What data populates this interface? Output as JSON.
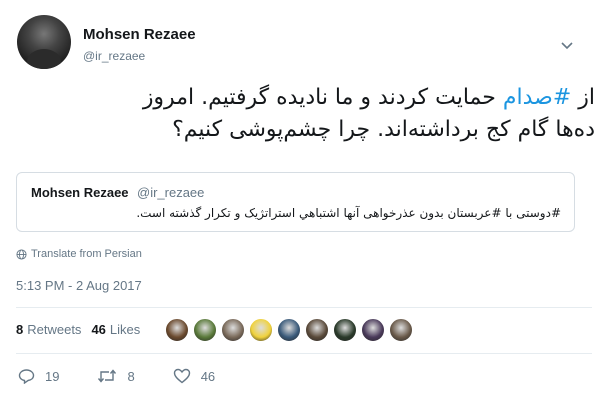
{
  "author": {
    "name": "Mohsen Rezaee",
    "handle": "@ir_rezaee"
  },
  "tweet": {
    "line1_tag": "#صدام",
    "line1_pre": "از ",
    "line1_post": " حمایت کردند و ما  نادیده گرفتیم. امروز",
    "line2": "ده‌ها گام کج برداشته‌اند. چرا چشم‌پوشی کنیم؟"
  },
  "quoted": {
    "name": "Mohsen Rezaee",
    "handle": "@ir_rezaee",
    "text": "#دوستی با #عربستان بدون عذرخواهی آنها  اشتباهي استراتژیک و تکرار گذشته است."
  },
  "translate_label": "Translate from Persian",
  "timestamp": "5:13 PM - 2 Aug 2017",
  "stats": {
    "retweets_count": "8",
    "retweets_label": "Retweets",
    "likes_count": "46",
    "likes_label": "Likes"
  },
  "likers_faces": [
    "#6b4a2e",
    "#5a7a3a",
    "#7a6a5a",
    "#f0d23c",
    "#3a5a7a",
    "#5a4a3a",
    "#2a3a2a",
    "#4a3a5a",
    "#6a5a4a"
  ],
  "actions": {
    "replies": "19",
    "retweets": "8",
    "likes": "46"
  },
  "colors": {
    "accent": "#1b95e0",
    "muted": "#657786"
  }
}
